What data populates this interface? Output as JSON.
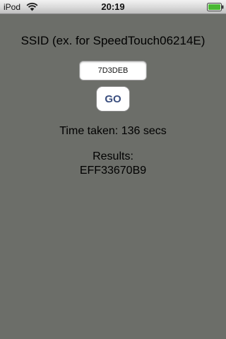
{
  "status_bar": {
    "carrier": "iPod",
    "time": "20:19",
    "wifi_icon": "wifi-icon",
    "battery_icon": "battery-icon",
    "battery_level": 1.0,
    "battery_color": "#49b832"
  },
  "form": {
    "ssid_label": "SSID (ex. for SpeedTouch06214E)",
    "ssid_value": "7D3DEB",
    "go_label": "GO"
  },
  "output": {
    "time_taken": "Time taken: 136 secs",
    "results_label": "Results:",
    "results_value": "EFF33670B9"
  },
  "colors": {
    "background": "#6c6e69",
    "button_text": "#3a4e7e"
  }
}
